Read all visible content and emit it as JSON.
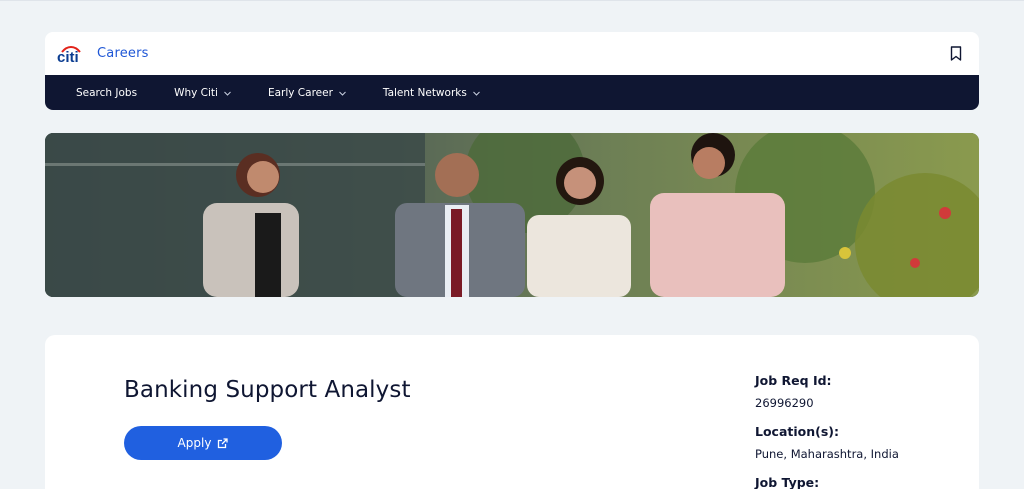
{
  "header": {
    "logo_text": "citi",
    "careers_label": "Careers"
  },
  "nav": {
    "items": [
      {
        "label": "Search Jobs",
        "has_dropdown": false
      },
      {
        "label": "Why Citi",
        "has_dropdown": true
      },
      {
        "label": "Early Career",
        "has_dropdown": true
      },
      {
        "label": "Talent Networks",
        "has_dropdown": true
      }
    ]
  },
  "job": {
    "title": "Banking Support Analyst",
    "apply_label": "Apply",
    "details": [
      {
        "label": "Job Req Id:",
        "value": "26996290"
      },
      {
        "label": "Location(s):",
        "value": "Pune, Maharashtra, India"
      },
      {
        "label": "Job Type:",
        "value": ""
      }
    ]
  },
  "colors": {
    "brand_blue": "#2060e0",
    "navy": "#0f1632",
    "logo_red": "#e2231a"
  }
}
